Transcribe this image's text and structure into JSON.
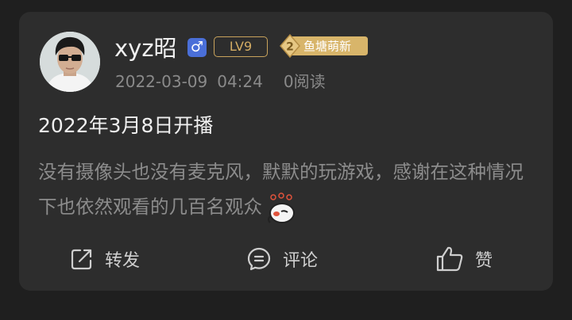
{
  "post": {
    "username": "xyz昭",
    "gender_symbol": "♂",
    "level": "LV9",
    "rank_number": "2",
    "rank_label": "鱼塘萌新",
    "date": "2022-03-09",
    "time": "04:24",
    "reads": "0阅读",
    "title": "2022年3月8日开播",
    "body": "没有摄像头也没有麦克风，默默的玩游戏，感谢在这种情况下也依然观看的几百名观众"
  },
  "actions": {
    "share_label": "转发",
    "comment_label": "评论",
    "like_label": "赞"
  },
  "colors": {
    "background": "#1f1f1f",
    "card": "#2d2d2d",
    "gender_badge": "#4a6fd8",
    "level_gold": "#d4ad64",
    "rank_gold": "#d8b56a"
  }
}
